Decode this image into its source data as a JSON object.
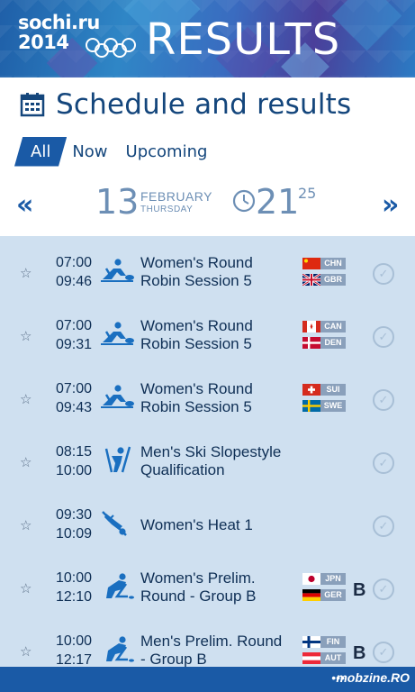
{
  "banner": {
    "logo_line1": "sochi.ru",
    "logo_line2": "2014",
    "title": "RESULTS"
  },
  "page": {
    "title": "Schedule and results"
  },
  "tabs": [
    {
      "label": "All",
      "active": true
    },
    {
      "label": "Now",
      "active": false
    },
    {
      "label": "Upcoming",
      "active": false
    }
  ],
  "date": {
    "prev": "«",
    "next": "»",
    "day": "13",
    "month": "FEBRUARY",
    "weekday": "THURSDAY",
    "hour": "21",
    "minute": "25"
  },
  "events": [
    {
      "start": "07:00",
      "end": "09:46",
      "line1": "Women's Round",
      "line2": "Robin Session 5",
      "sport_icon": "curling-icon",
      "teams": [
        {
          "code": "CHN",
          "flag": "china-flag-icon"
        },
        {
          "code": "GBR",
          "flag": "uk-flag-icon"
        }
      ],
      "score": ""
    },
    {
      "start": "07:00",
      "end": "09:31",
      "line1": "Women's Round",
      "line2": "Robin Session 5",
      "sport_icon": "curling-icon",
      "teams": [
        {
          "code": "CAN",
          "flag": "canada-flag-icon"
        },
        {
          "code": "DEN",
          "flag": "denmark-flag-icon"
        }
      ],
      "score": ""
    },
    {
      "start": "07:00",
      "end": "09:43",
      "line1": "Women's Round",
      "line2": "Robin Session 5",
      "sport_icon": "curling-icon",
      "teams": [
        {
          "code": "SUI",
          "flag": "switzerland-flag-icon"
        },
        {
          "code": "SWE",
          "flag": "sweden-flag-icon"
        }
      ],
      "score": ""
    },
    {
      "start": "08:15",
      "end": "10:00",
      "line1": "Men's Ski Slopestyle",
      "line2": "Qualification",
      "sport_icon": "ski-slopestyle-icon",
      "teams": [],
      "score": ""
    },
    {
      "start": "09:30",
      "end": "10:09",
      "line1": "Women's Heat 1",
      "line2": "",
      "sport_icon": "ski-cross-icon",
      "teams": [],
      "score": ""
    },
    {
      "start": "10:00",
      "end": "12:10",
      "line1": "Women's Prelim.",
      "line2": "Round - Group B",
      "sport_icon": "ice-hockey-icon",
      "teams": [
        {
          "code": "JPN",
          "flag": "japan-flag-icon"
        },
        {
          "code": "GER",
          "flag": "germany-flag-icon"
        }
      ],
      "score": "B"
    },
    {
      "start": "10:00",
      "end": "12:17",
      "line1": "Men's Prelim. Round",
      "line2": "- Group B",
      "sport_icon": "ice-hockey-icon",
      "teams": [
        {
          "code": "FIN",
          "flag": "finland-flag-icon"
        },
        {
          "code": "AUT",
          "flag": "austria-flag-icon"
        }
      ],
      "score": "B"
    }
  ],
  "footer": {
    "more": "•••",
    "watermark": "mobzine.RO"
  },
  "colors": {
    "accent": "#1a5aa6",
    "title_text": "#14467c",
    "list_bg": "#cfe0f0",
    "muted": "#6d8fb5"
  }
}
